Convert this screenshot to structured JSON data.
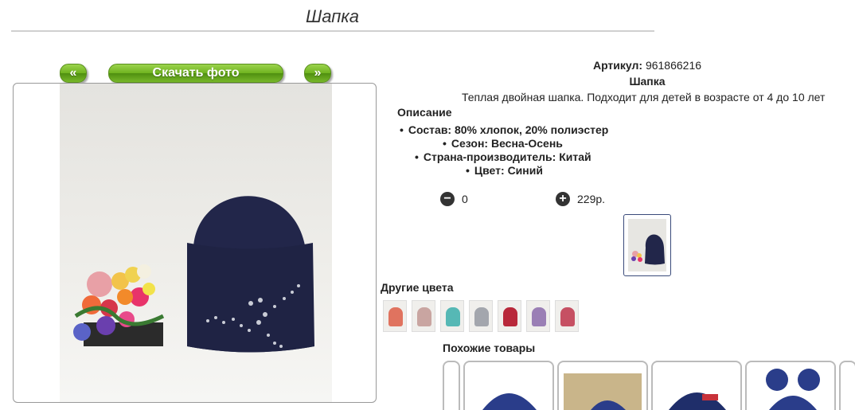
{
  "page": {
    "title": "Шапка"
  },
  "gallery": {
    "prev_label": "«",
    "next_label": "»",
    "download_label": "Скачать фото"
  },
  "product": {
    "sku_label": "Артикул:",
    "sku_value": "961866216",
    "name": "Шапка",
    "description": "Теплая двойная шапка. Подходит для детей в возрасте от 4 до 10 лет",
    "description_heading": "Описание",
    "attributes": [
      "Состав: 80% хлопок, 20% полиэстер",
      "Сезон: Весна-Осень",
      "Страна-производитель: Китай",
      "Цвет: Синий"
    ],
    "quantity": "0",
    "price": "229р."
  },
  "other_colors": {
    "heading": "Другие цвета",
    "colors": [
      "#e0735f",
      "#c9a5a1",
      "#56b8b5",
      "#a3a6ad",
      "#b8283a",
      "#9a7fb5",
      "#c65063"
    ]
  },
  "similar": {
    "heading": "Похожие товары"
  },
  "icons": {
    "minus": "minus-circle-icon",
    "plus": "plus-circle-icon"
  }
}
